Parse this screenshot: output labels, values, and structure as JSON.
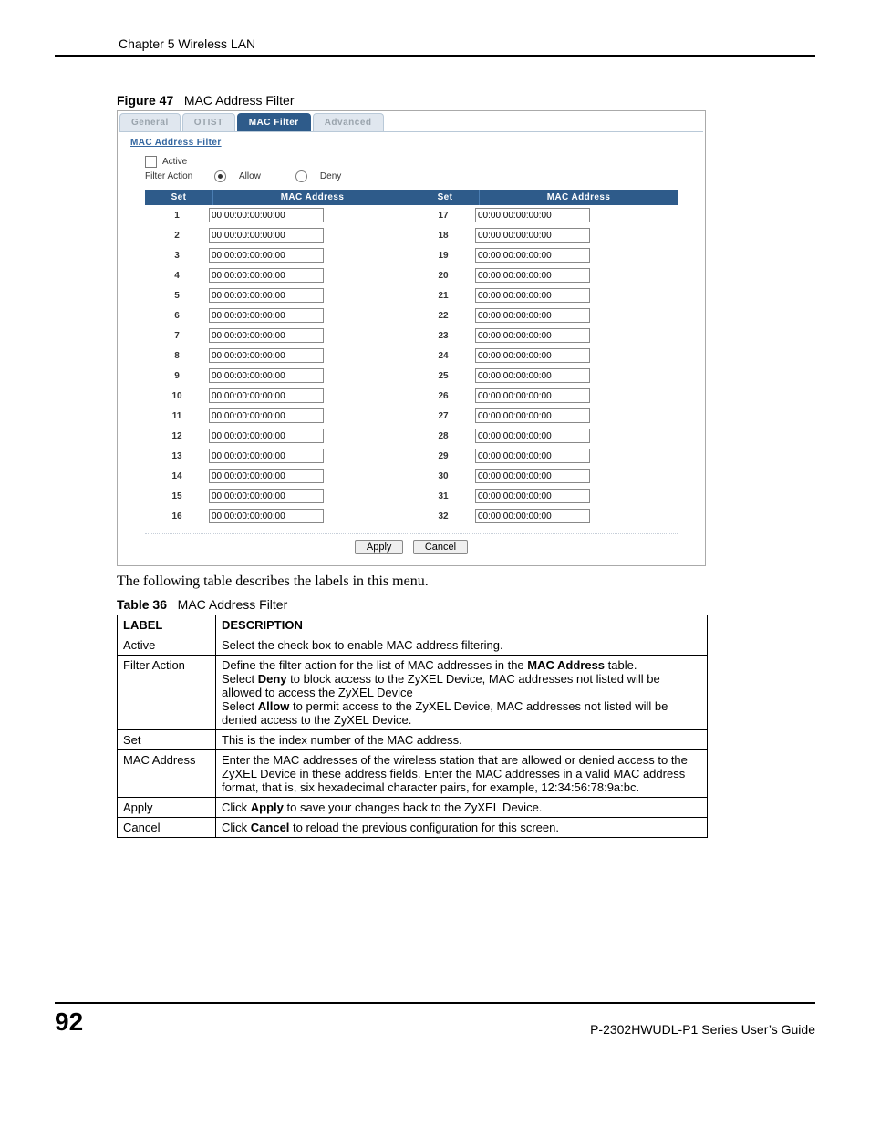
{
  "header": {
    "chapter": "Chapter 5 Wireless LAN"
  },
  "figure": {
    "label": "Figure 47",
    "title": "MAC Address Filter"
  },
  "screenshot": {
    "tabs": {
      "general": "General",
      "otist": "OTIST",
      "mac_filter": "MAC Filter",
      "advanced": "Advanced",
      "active_index": 2
    },
    "panel_title": "MAC Address Filter",
    "active_label": "Active",
    "filter_action_label": "Filter Action",
    "allow_label": "Allow",
    "deny_label": "Deny",
    "filter_action_selected": "allow",
    "col_set": "Set",
    "col_mac": "MAC Address",
    "rows_left": [
      {
        "set": "1",
        "mac": "00:00:00:00:00:00"
      },
      {
        "set": "2",
        "mac": "00:00:00:00:00:00"
      },
      {
        "set": "3",
        "mac": "00:00:00:00:00:00"
      },
      {
        "set": "4",
        "mac": "00:00:00:00:00:00"
      },
      {
        "set": "5",
        "mac": "00:00:00:00:00:00"
      },
      {
        "set": "6",
        "mac": "00:00:00:00:00:00"
      },
      {
        "set": "7",
        "mac": "00:00:00:00:00:00"
      },
      {
        "set": "8",
        "mac": "00:00:00:00:00:00"
      },
      {
        "set": "9",
        "mac": "00:00:00:00:00:00"
      },
      {
        "set": "10",
        "mac": "00:00:00:00:00:00"
      },
      {
        "set": "11",
        "mac": "00:00:00:00:00:00"
      },
      {
        "set": "12",
        "mac": "00:00:00:00:00:00"
      },
      {
        "set": "13",
        "mac": "00:00:00:00:00:00"
      },
      {
        "set": "14",
        "mac": "00:00:00:00:00:00"
      },
      {
        "set": "15",
        "mac": "00:00:00:00:00:00"
      },
      {
        "set": "16",
        "mac": "00:00:00:00:00:00"
      }
    ],
    "rows_right": [
      {
        "set": "17",
        "mac": "00:00:00:00:00:00"
      },
      {
        "set": "18",
        "mac": "00:00:00:00:00:00"
      },
      {
        "set": "19",
        "mac": "00:00:00:00:00:00"
      },
      {
        "set": "20",
        "mac": "00:00:00:00:00:00"
      },
      {
        "set": "21",
        "mac": "00:00:00:00:00:00"
      },
      {
        "set": "22",
        "mac": "00:00:00:00:00:00"
      },
      {
        "set": "23",
        "mac": "00:00:00:00:00:00"
      },
      {
        "set": "24",
        "mac": "00:00:00:00:00:00"
      },
      {
        "set": "25",
        "mac": "00:00:00:00:00:00"
      },
      {
        "set": "26",
        "mac": "00:00:00:00:00:00"
      },
      {
        "set": "27",
        "mac": "00:00:00:00:00:00"
      },
      {
        "set": "28",
        "mac": "00:00:00:00:00:00"
      },
      {
        "set": "29",
        "mac": "00:00:00:00:00:00"
      },
      {
        "set": "30",
        "mac": "00:00:00:00:00:00"
      },
      {
        "set": "31",
        "mac": "00:00:00:00:00:00"
      },
      {
        "set": "32",
        "mac": "00:00:00:00:00:00"
      }
    ],
    "apply": "Apply",
    "cancel": "Cancel"
  },
  "paragraph": "The following table describes the labels in this menu.",
  "table": {
    "label": "Table 36",
    "title": "MAC Address Filter",
    "head_label": "LABEL",
    "head_desc": "DESCRIPTION",
    "rows": {
      "active": {
        "label": "Active",
        "desc": "Select the check box to enable MAC address filtering."
      },
      "filter_action": {
        "label": "Filter Action",
        "line1_pre": "Define the filter action for the list of MAC addresses in the ",
        "line1_b": "MAC Address",
        "line1_post": " table.",
        "line2_pre": "Select ",
        "line2_b": "Deny",
        "line2_post": " to block access to the ZyXEL Device, MAC addresses not listed will be allowed to access the ZyXEL Device",
        "line3_pre": "Select ",
        "line3_b": "Allow",
        "line3_post": " to permit access to the ZyXEL Device, MAC addresses not listed will be denied access to the ZyXEL Device."
      },
      "set": {
        "label": "Set",
        "desc": "This is the index number of the MAC address."
      },
      "mac": {
        "label": "MAC Address",
        "desc": "Enter the MAC addresses of the wireless station that are allowed or denied access to the ZyXEL Device in these address fields. Enter the MAC addresses in a valid MAC address format, that is, six hexadecimal character pairs, for example, 12:34:56:78:9a:bc."
      },
      "apply": {
        "label": "Apply",
        "pre": "Click ",
        "b": "Apply",
        "post": " to save your changes back to the ZyXEL Device."
      },
      "cancel": {
        "label": "Cancel",
        "pre": "Click ",
        "b": "Cancel",
        "post": " to reload the previous configuration for this screen."
      }
    }
  },
  "footer": {
    "page": "92",
    "guide": "P-2302HWUDL-P1 Series User’s Guide"
  }
}
